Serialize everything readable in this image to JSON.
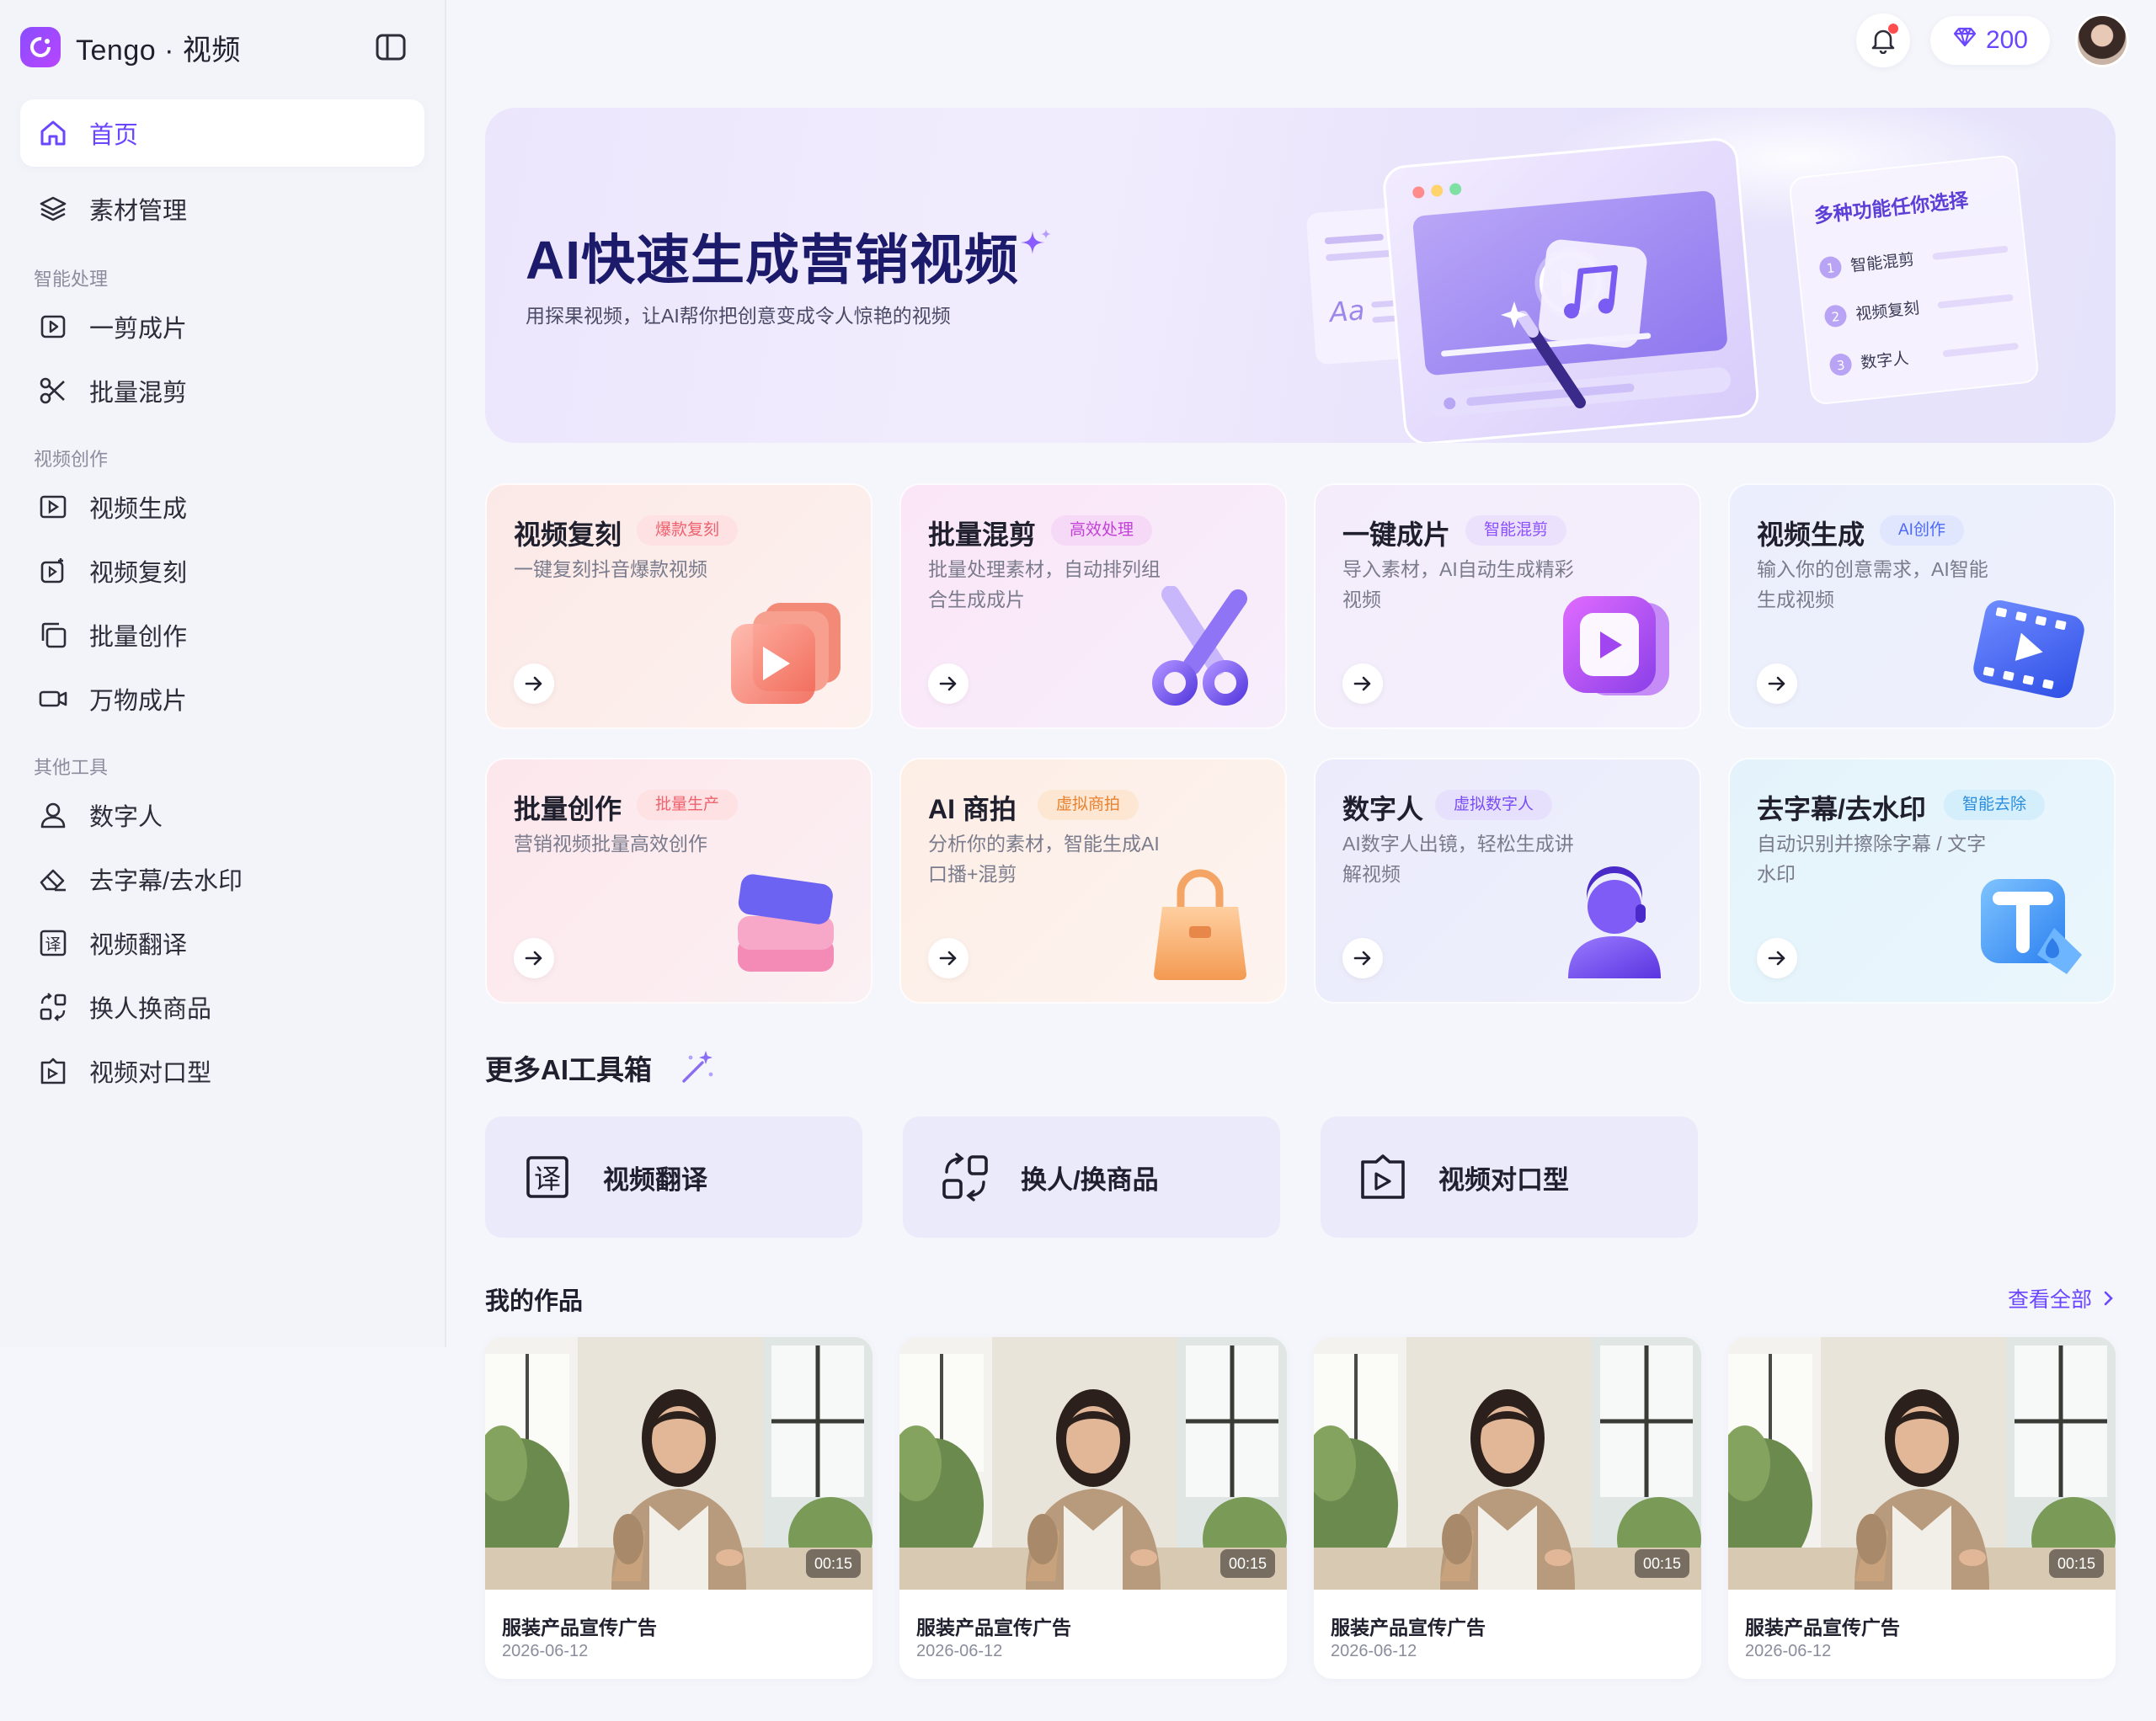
{
  "app": {
    "name": "Tengo · 视频"
  },
  "sidebar": {
    "top_items": [
      {
        "label": "首页",
        "icon": "home-icon",
        "active": true
      },
      {
        "label": "素材管理",
        "icon": "layers-icon"
      }
    ],
    "sections": [
      {
        "title": "智能处理",
        "items": [
          {
            "label": "一剪成片",
            "icon": "play-square-icon"
          },
          {
            "label": "批量混剪",
            "icon": "scissors-icon"
          }
        ]
      },
      {
        "title": "视频创作",
        "items": [
          {
            "label": "视频生成",
            "icon": "video-play-icon"
          },
          {
            "label": "视频复刻",
            "icon": "video-copy-icon"
          },
          {
            "label": "批量创作",
            "icon": "copy-icon"
          },
          {
            "label": "万物成片",
            "icon": "camera-icon"
          }
        ]
      },
      {
        "title": "其他工具",
        "items": [
          {
            "label": "数字人",
            "icon": "user-icon"
          },
          {
            "label": "去字幕/去水印",
            "icon": "eraser-icon"
          },
          {
            "label": "视频翻译",
            "icon": "translate-icon"
          },
          {
            "label": "换人换商品",
            "icon": "swap-icon"
          },
          {
            "label": "视频对口型",
            "icon": "lip-sync-icon"
          }
        ]
      }
    ]
  },
  "topbar": {
    "credits": "200",
    "notification_dot": true
  },
  "hero": {
    "title": "AI快速生成营销视频",
    "subtitle": "用探果视频，让AI帮你把创意变成令人惊艳的视频",
    "art": {
      "font_label": "Aa",
      "panel_title": "多种功能任你选择",
      "panel_items": [
        {
          "num": "1",
          "label": "智能混剪"
        },
        {
          "num": "2",
          "label": "视频复刻"
        },
        {
          "num": "3",
          "label": "数字人"
        }
      ]
    }
  },
  "cards": [
    {
      "title": "视频复刻",
      "tag": "爆款复刻",
      "desc": "一键复刻抖音爆款视频",
      "tag_color": "#f0616e",
      "tag_bg": "#fde1e3",
      "bg": [
        "#fbe9e7",
        "#fdf1ee"
      ]
    },
    {
      "title": "批量混剪",
      "tag": "高效处理",
      "desc": "批量处理素材，自动排列组合生成成片",
      "tag_color": "#c240d8",
      "tag_bg": "#f6d9f6",
      "bg": [
        "#fbe6f7",
        "#f7eefc"
      ]
    },
    {
      "title": "一键成片",
      "tag": "智能混剪",
      "desc": "导入素材，AI自动生成精彩视频",
      "tag_color": "#8a4dff",
      "tag_bg": "#ebe1fd",
      "bg": [
        "#f4ecfb",
        "#f4f0fc"
      ]
    },
    {
      "title": "视频生成",
      "tag": "AI创作",
      "desc": "输入你的创意需求，AI智能生成视频",
      "tag_color": "#4b69f5",
      "tag_bg": "#dfe6fd",
      "bg": [
        "#ebeefc",
        "#eef1fc"
      ]
    },
    {
      "title": "批量创作",
      "tag": "批量生产",
      "desc": "营销视频批量高效创作",
      "tag_color": "#f0616e",
      "tag_bg": "#fde1e3",
      "bg": [
        "#fce7ec",
        "#fbf0f3"
      ]
    },
    {
      "title": "AI 商拍",
      "tag": "虚拟商拍",
      "desc": "分析你的素材，智能生成AI口播+混剪",
      "tag_color": "#e9822f",
      "tag_bg": "#fde6d2",
      "bg": [
        "#fdeee6",
        "#fdf3ef"
      ]
    },
    {
      "title": "数字人",
      "tag": "虚拟数字人",
      "desc": "AI数字人出镜，轻松生成讲解视频",
      "tag_color": "#7a4ef5",
      "tag_bg": "#e6e0fc",
      "bg": [
        "#ebebfb",
        "#eef0fc"
      ]
    },
    {
      "title": "去字幕/去水印",
      "tag": "智能去除",
      "desc": "自动识别并擦除字幕 / 文字水印",
      "tag_color": "#2a8ee0",
      "tag_bg": "#d4eefb",
      "bg": [
        "#e4f3fb",
        "#eaf6fc"
      ]
    }
  ],
  "more_tools": {
    "title": "更多AI工具箱",
    "items": [
      {
        "label": "视频翻译",
        "icon": "translate-icon"
      },
      {
        "label": "换人/换商品",
        "icon": "swap-icon"
      },
      {
        "label": "视频对口型",
        "icon": "lip-sync-icon"
      }
    ]
  },
  "works": {
    "title": "我的作品",
    "view_all": "查看全部",
    "items": [
      {
        "title": "服装产品宣传广告",
        "date": "2026-06-12",
        "duration": "00:15"
      },
      {
        "title": "服装产品宣传广告",
        "date": "2026-06-12",
        "duration": "00:15"
      },
      {
        "title": "服装产品宣传广告",
        "date": "2026-06-12",
        "duration": "00:15"
      },
      {
        "title": "服装产品宣传广告",
        "date": "2026-06-12",
        "duration": "00:15"
      }
    ]
  }
}
